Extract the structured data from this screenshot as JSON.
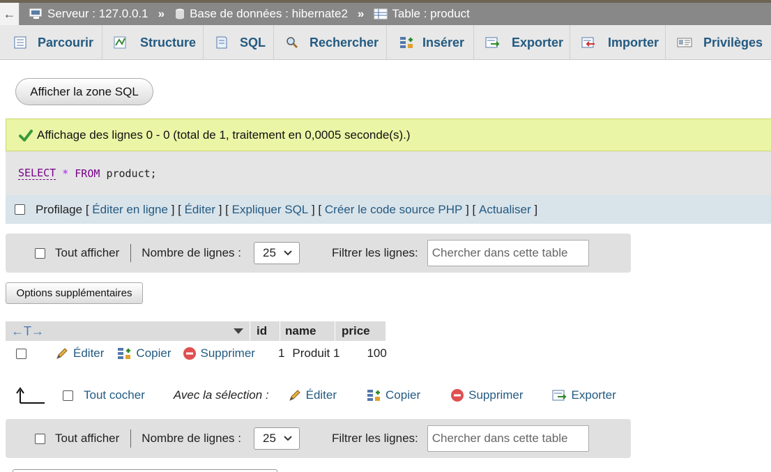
{
  "breadcrumb": {
    "back": "←",
    "server": "Serveur : 127.0.0.1",
    "separator": "»",
    "database": "Base de données : hibernate2",
    "table": "Table : product"
  },
  "tabs": [
    {
      "label": "Parcourir",
      "icon": "browse-icon"
    },
    {
      "label": "Structure",
      "icon": "structure-icon"
    },
    {
      "label": "SQL",
      "icon": "sql-icon"
    },
    {
      "label": "Rechercher",
      "icon": "search-icon"
    },
    {
      "label": "Insérer",
      "icon": "insert-icon"
    },
    {
      "label": "Exporter",
      "icon": "export-icon"
    },
    {
      "label": "Importer",
      "icon": "import-icon"
    },
    {
      "label": "Privilèges",
      "icon": "privileges-icon"
    }
  ],
  "sql_zone_button": "Afficher la zone SQL",
  "success_message": "Affichage des lignes 0 - 0 (total de 1, traitement en 0,0005 seconde(s).)",
  "query": {
    "select": "SELECT",
    "star": "*",
    "from": "FROM",
    "table": "product;"
  },
  "profilage": {
    "label": "Profilage",
    "links": [
      "Éditer en ligne",
      "Éditer",
      "Expliquer SQL",
      "Créer le code source PHP",
      "Actualiser"
    ]
  },
  "navigation": {
    "show_all": "Tout afficher",
    "rows_label": "Nombre de lignes :",
    "rows_value": "25",
    "filter_label": "Filtrer les lignes:",
    "filter_placeholder": "Chercher dans cette table"
  },
  "options_button": "Options supplémentaires",
  "table": {
    "arrows": "←T→",
    "columns": [
      "id",
      "name",
      "price"
    ],
    "rows": [
      {
        "edit": "Éditer",
        "copy": "Copier",
        "delete": "Supprimer",
        "id": "1",
        "name": "Produit 1",
        "price": "100"
      }
    ]
  },
  "bulk": {
    "check_all": "Tout cocher",
    "with_selection": "Avec la sélection :",
    "edit": "Éditer",
    "copy": "Copier",
    "delete": "Supprimer",
    "export": "Exporter"
  },
  "colors": {
    "link": "#235a81",
    "success_bg": "#ebf5a6",
    "breadcrumb_bg": "#888888"
  }
}
